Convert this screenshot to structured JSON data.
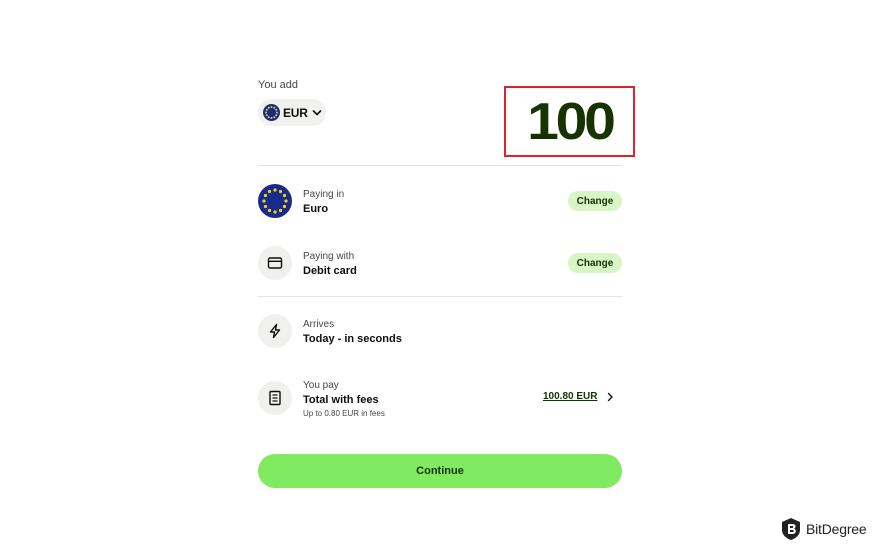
{
  "add": {
    "label": "You add",
    "currency": "EUR",
    "amount": "100"
  },
  "rows": {
    "paying_in": {
      "label": "Paying in",
      "value": "Euro",
      "action": "Change"
    },
    "paying_with": {
      "label": "Paying with",
      "value": "Debit card",
      "action": "Change"
    },
    "arrives": {
      "label": "Arrives",
      "value": "Today - in seconds"
    },
    "you_pay": {
      "label": "You pay",
      "value": "Total with fees",
      "sub": "Up to 0.80 EUR in fees",
      "amount": "100.80 EUR"
    }
  },
  "continue_label": "Continue",
  "watermark": "BitDegree",
  "icons": {
    "currency_flag": "eu-flag-icon",
    "currency_dropdown": "chevron-down-icon",
    "paying_in": "eu-flag-icon",
    "paying_with": "card-icon",
    "arrives": "lightning-icon",
    "you_pay": "receipt-icon",
    "fee_details": "chevron-right-icon"
  },
  "colors": {
    "brand_green": "#80ea60",
    "light_green": "#d7f5c5",
    "dark_green": "#163300",
    "highlight_red": "#e0202b",
    "eu_blue": "#1a2a8c",
    "eu_star": "#f5cf15"
  }
}
